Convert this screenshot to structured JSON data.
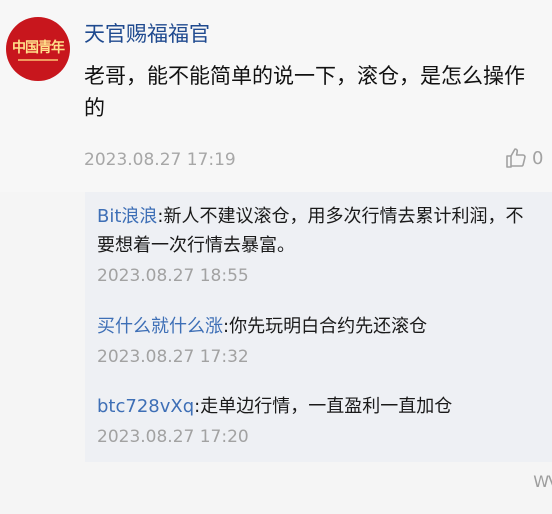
{
  "comment": {
    "username": "天官赐福福官",
    "avatar_text": "中国青年",
    "text": "老哥，能不能简单的说一下，滚仓，是怎么操作的",
    "time": "2023.08.27 17:19",
    "like_count": "0"
  },
  "replies": [
    {
      "name": "Bit浪浪",
      "text": ":新人不建议滚仓，用多次行情去累计利润，不要想着一次行情去暴富。",
      "time": "2023.08.27 18:55"
    },
    {
      "name": "买什么就什么涨",
      "text": ":你先玩明白合约先还滚仓",
      "time": "2023.08.27 17:32"
    },
    {
      "name": "btc728vXq",
      "text": ":走单边行情，一直盈利一直加仓",
      "time": "2023.08.27 17:20"
    }
  ],
  "watermark": "WV",
  "colors": {
    "name_blue": "#3e6fb6",
    "username_blue": "#1f4a8f",
    "avatar_red": "#c8161d"
  }
}
